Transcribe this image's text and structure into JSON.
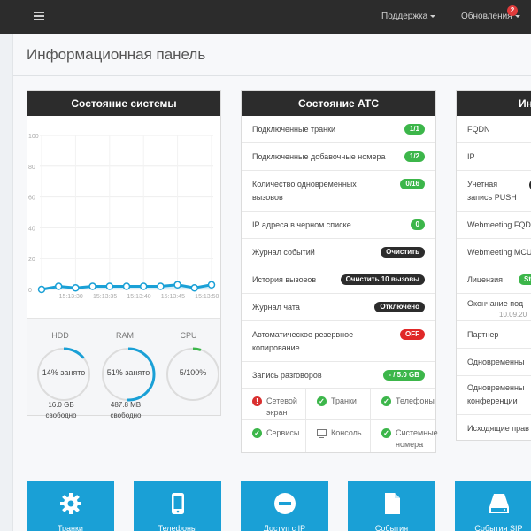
{
  "topbar": {
    "support": "Поддержка",
    "updates": "Обновления",
    "updates_count": "2"
  },
  "page": {
    "title": "Информационная панель"
  },
  "system": {
    "title": "Состояние системы",
    "chart_data": {
      "type": "line",
      "y_ticks": [
        "100",
        "80",
        "60",
        "40",
        "20",
        "0"
      ],
      "ylim": [
        0,
        100
      ],
      "x_labels": [
        "15:13:30",
        "15:13:35",
        "15:13:40",
        "15:13:45",
        "15:13:50"
      ],
      "values": [
        0,
        2,
        1,
        2,
        2,
        2,
        2,
        2,
        3,
        1,
        3
      ]
    },
    "gauges": [
      {
        "title": "HDD",
        "value": "14% занято",
        "pct": 14,
        "sub1": "16.0 GB",
        "sub2": "свободно"
      },
      {
        "title": "RAM",
        "value": "51% занято",
        "pct": 51,
        "sub1": "487.8 MB",
        "sub2": "свободно"
      },
      {
        "title": "CPU",
        "value": "5/100%",
        "pct": 5
      }
    ]
  },
  "atc": {
    "title": "Состояние АТС",
    "rows": [
      {
        "label": "Подключенные транки",
        "value": "1/1"
      },
      {
        "label": "Подключенные добавочные номера",
        "value": "1/2"
      },
      {
        "label": "Количество одновременных вызовов",
        "value": "0/16"
      },
      {
        "label": "IP адреса в черном списке",
        "value": "0"
      },
      {
        "label": "Журнал событий",
        "value": "Очистить"
      },
      {
        "label": "История вызовов",
        "value": "Очистить 10 вызовы"
      },
      {
        "label": "Журнал чата",
        "value": "Отключено"
      },
      {
        "label": "Автоматическое резервное копирование",
        "value": "OFF"
      },
      {
        "label": "Запись разговоров",
        "value": "- / 5.0 GB"
      }
    ],
    "status": [
      {
        "label": "Сетевой экран"
      },
      {
        "label": "Транки"
      },
      {
        "label": "Телефоны"
      },
      {
        "label": "Сервисы"
      },
      {
        "label": "Консоль"
      },
      {
        "label": "Системные номера"
      }
    ]
  },
  "info": {
    "title": "Ин",
    "rows": [
      {
        "label": "FQDN"
      },
      {
        "label": "IP"
      },
      {
        "label": "Учетная запись PUSH"
      },
      {
        "label": "Webmeeting FQD"
      },
      {
        "label": "Webmeeting MCU"
      },
      {
        "label": "Лицензия",
        "value": "St"
      },
      {
        "label": "Окончание под",
        "sub": "10.09.20"
      },
      {
        "label": "Партнер"
      },
      {
        "label": "Одновременны"
      },
      {
        "label": "Одновременны конференции"
      },
      {
        "label": "Исходящие прав"
      }
    ]
  },
  "tiles": [
    {
      "label": "Транки",
      "icon": "gear-icon"
    },
    {
      "label": "Телефоны",
      "icon": "phone-icon"
    },
    {
      "label": "Доступ с IP",
      "icon": "block-icon"
    },
    {
      "label": "События",
      "icon": "document-icon"
    },
    {
      "label": "События SIP",
      "icon": "drive-icon"
    }
  ]
}
